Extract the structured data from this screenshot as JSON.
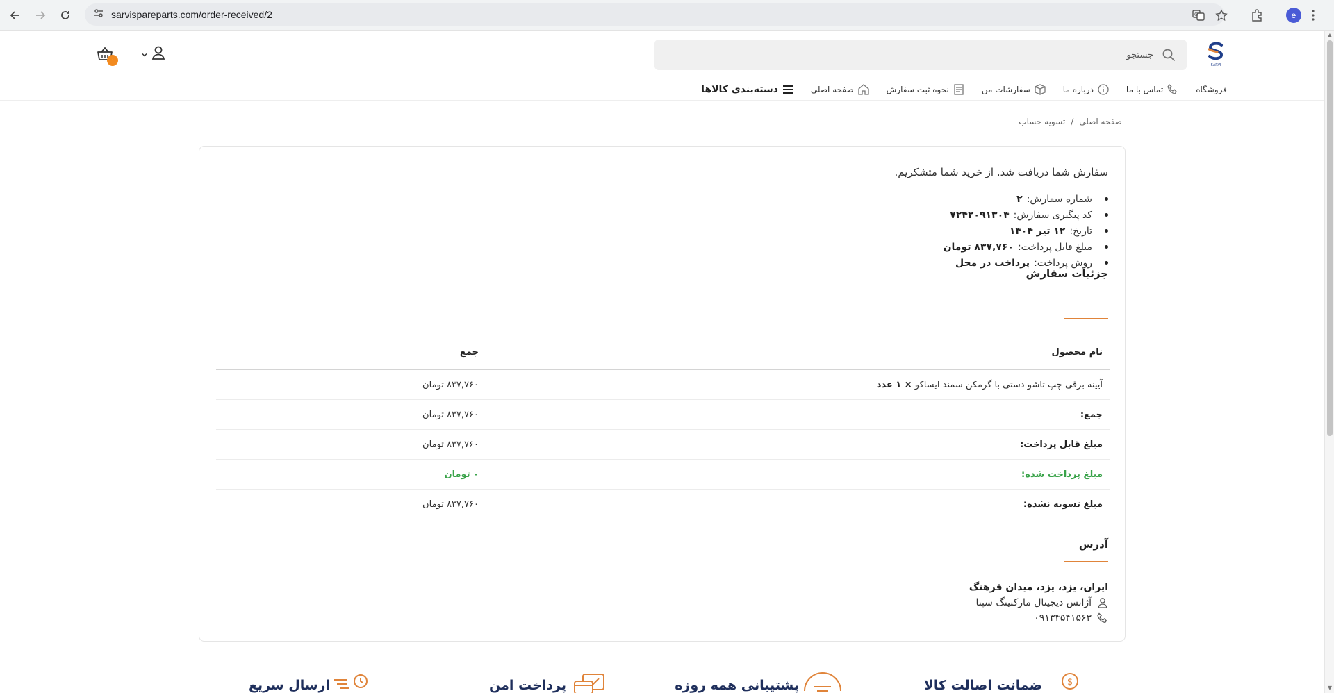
{
  "browser": {
    "url": "sarvispareparts.com/order-received/2",
    "profile_initial": "e"
  },
  "header": {
    "search_placeholder": "جستجو",
    "cart_count": "۰",
    "logo_text": "SARVI"
  },
  "nav": {
    "categories": "دسته‌بندی کالاها",
    "items": [
      {
        "label": "صفحه اصلی",
        "icon": "home-icon"
      },
      {
        "label": "نحوه ثبت سفارش",
        "icon": "document-icon"
      },
      {
        "label": "سفارشات من",
        "icon": "box-icon"
      },
      {
        "label": "درباره ما",
        "icon": "info-icon"
      },
      {
        "label": "تماس با ما",
        "icon": "phone-icon"
      },
      {
        "label": "فروشگاه",
        "icon": ""
      }
    ]
  },
  "breadcrumb": {
    "home": "صفحه اصلی",
    "separator": "/",
    "current": "تسویه حساب"
  },
  "order": {
    "thanks": "سفارش شما دریافت شد. از خرید شما متشکریم.",
    "overview": [
      {
        "label": "شماره سفارش:",
        "value": "۲"
      },
      {
        "label": "کد پیگیری سفارش:",
        "value": "۷۲۴۲۰۹۱۳۰۴"
      },
      {
        "label": "تاریخ:",
        "value": "۱۲ تیر ۱۴۰۴"
      },
      {
        "label": "مبلغ قابل پرداخت:",
        "value": "۸۳۷,۷۶۰ تومان"
      },
      {
        "label": "روش پرداخت:",
        "value": "پرداخت در محل"
      }
    ],
    "details_title": "جزئیات سفارش",
    "table": {
      "headers": {
        "product": "نام محصول",
        "total": "جمع"
      },
      "product_name": "آیینه برقی چپ تاشو دستی با گرمکن سمند ایساکو",
      "product_qty": "× ۱ عدد",
      "product_total": "۸۳۷,۷۶۰ تومان",
      "rows": [
        {
          "label": "جمع:",
          "value": "۸۳۷,۷۶۰ تومان"
        },
        {
          "label": "مبلغ قابل پرداخت:",
          "value": "۸۳۷,۷۶۰ تومان"
        },
        {
          "label": "مبلغ پرداخت شده:",
          "value": "۰ تومان"
        },
        {
          "label": "مبلغ تسویه نشده:",
          "value": "۸۳۷,۷۶۰ تومان"
        }
      ]
    },
    "address_title": "آدرس",
    "address": {
      "line": "ایران، یزد، یزد، میدان فرهنگ",
      "name": "آژانس دیجیتال مارکتینگ سپتا",
      "phone": "۰۹۱۳۴۵۴۱۵۶۳"
    }
  },
  "features": [
    {
      "title": "ضمانت اصالت کالا",
      "icon": "coin-shield-icon"
    },
    {
      "title": "پشتیبانی همه روزه",
      "icon": "support-icon"
    },
    {
      "title": "پرداخت امن",
      "icon": "secure-payment-icon"
    },
    {
      "title": "ارسال سریع",
      "icon": "fast-delivery-icon"
    }
  ],
  "colors": {
    "accent": "#e0843a",
    "cart_badge": "#f28a1f",
    "paid_green": "#3aa34a",
    "feature_title": "#1f2f5c"
  }
}
